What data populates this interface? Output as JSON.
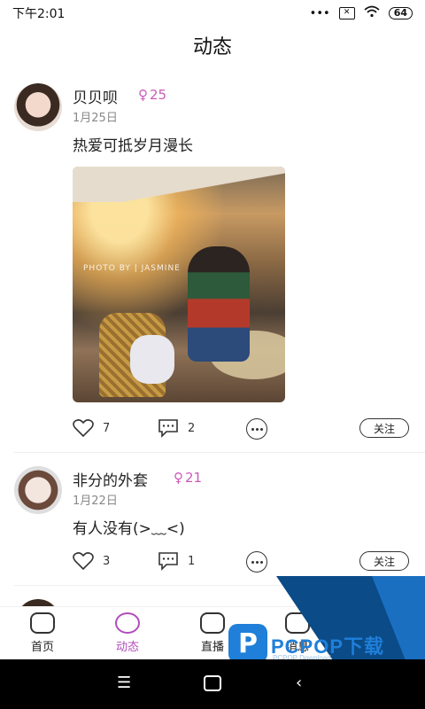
{
  "status_bar": {
    "time": "下午2:01",
    "dots": "•••",
    "battery": "64"
  },
  "header": {
    "title": "动态"
  },
  "posts": [
    {
      "name": "贝贝呗",
      "badge_count": "25",
      "date": "1月25日",
      "text": "热爱可抵岁月漫长",
      "photo_watermark": "PHOTO BY | JASMINE",
      "likes": "7",
      "comments": "2",
      "follow_label": "关注"
    },
    {
      "name": "非分的外套",
      "badge_count": "21",
      "date": "1月22日",
      "text": "有人没有(>﹏<)",
      "likes": "3",
      "comments": "1",
      "follow_label": "关注"
    }
  ],
  "tabs": [
    {
      "label": "首页",
      "active": false
    },
    {
      "label": "动态",
      "active": true
    },
    {
      "label": "直播",
      "active": false
    },
    {
      "label": "消息",
      "active": false
    }
  ],
  "watermark": {
    "brand": "PCPOP下载",
    "sub": "PCPOP Download",
    "logo": "P"
  },
  "colors": {
    "accent": "#b04dbb",
    "badge": "#cc5ab8"
  }
}
